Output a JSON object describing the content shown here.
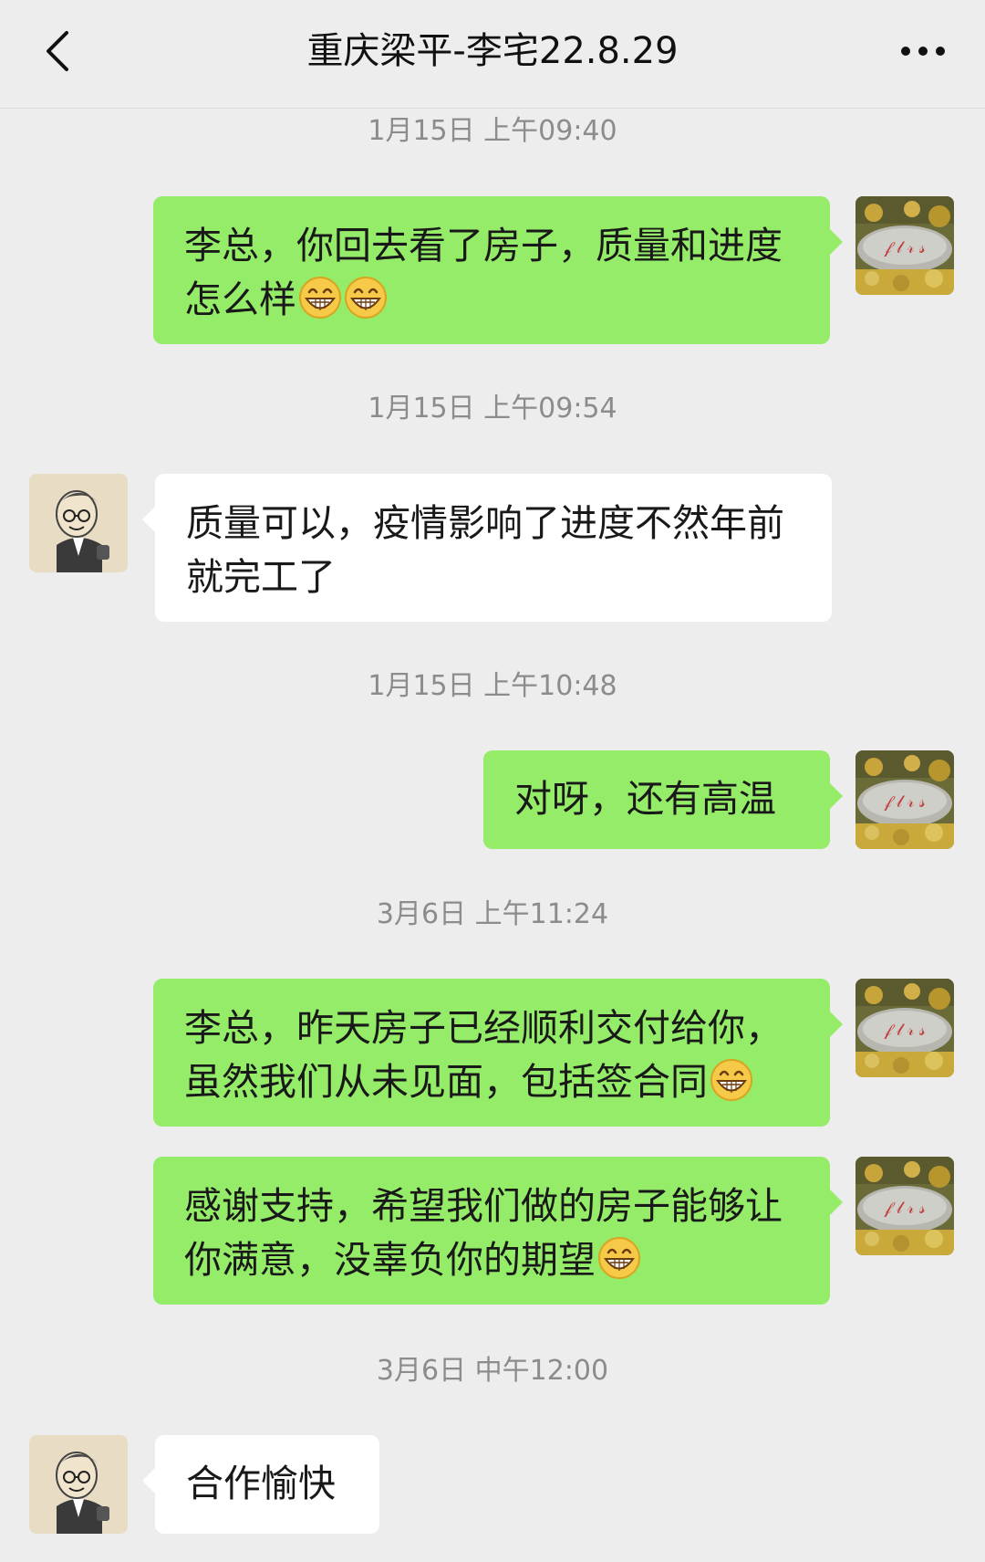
{
  "header": {
    "title": "重庆梁平-李宅22.8.29",
    "back_icon": "chevron-left-icon",
    "more_icon": "more-dots-icon"
  },
  "messages": [
    {
      "timestamp": "1月15日 上午09:40",
      "sender": "self",
      "text": "李总，你回去看了房子，质量和进度怎么样",
      "emoji_count": 2
    },
    {
      "timestamp": "1月15日 上午09:54",
      "sender": "other",
      "text": "质量可以，疫情影响了进度不然年前就完工了",
      "emoji_count": 0
    },
    {
      "timestamp": "1月15日 上午10:48",
      "sender": "self",
      "text": "对呀，还有高温",
      "emoji_count": 0
    },
    {
      "timestamp": "3月6日 上午11:24",
      "sender": "self",
      "text": "李总，昨天房子已经顺利交付给你，虽然我们从未见面，包括签合同",
      "emoji_count": 1
    },
    {
      "timestamp": "",
      "sender": "self",
      "text": "感谢支持，希望我们做的房子能够让你满意，没辜负你的期望",
      "emoji_count": 1
    },
    {
      "timestamp": "3月6日 中午12:00",
      "sender": "other",
      "text": "合作愉快",
      "emoji_count": 0
    }
  ],
  "colors": {
    "background": "#ededed",
    "sent_bubble": "#95ec69",
    "received_bubble": "#ffffff",
    "timestamp_text": "#8c8c8c"
  }
}
